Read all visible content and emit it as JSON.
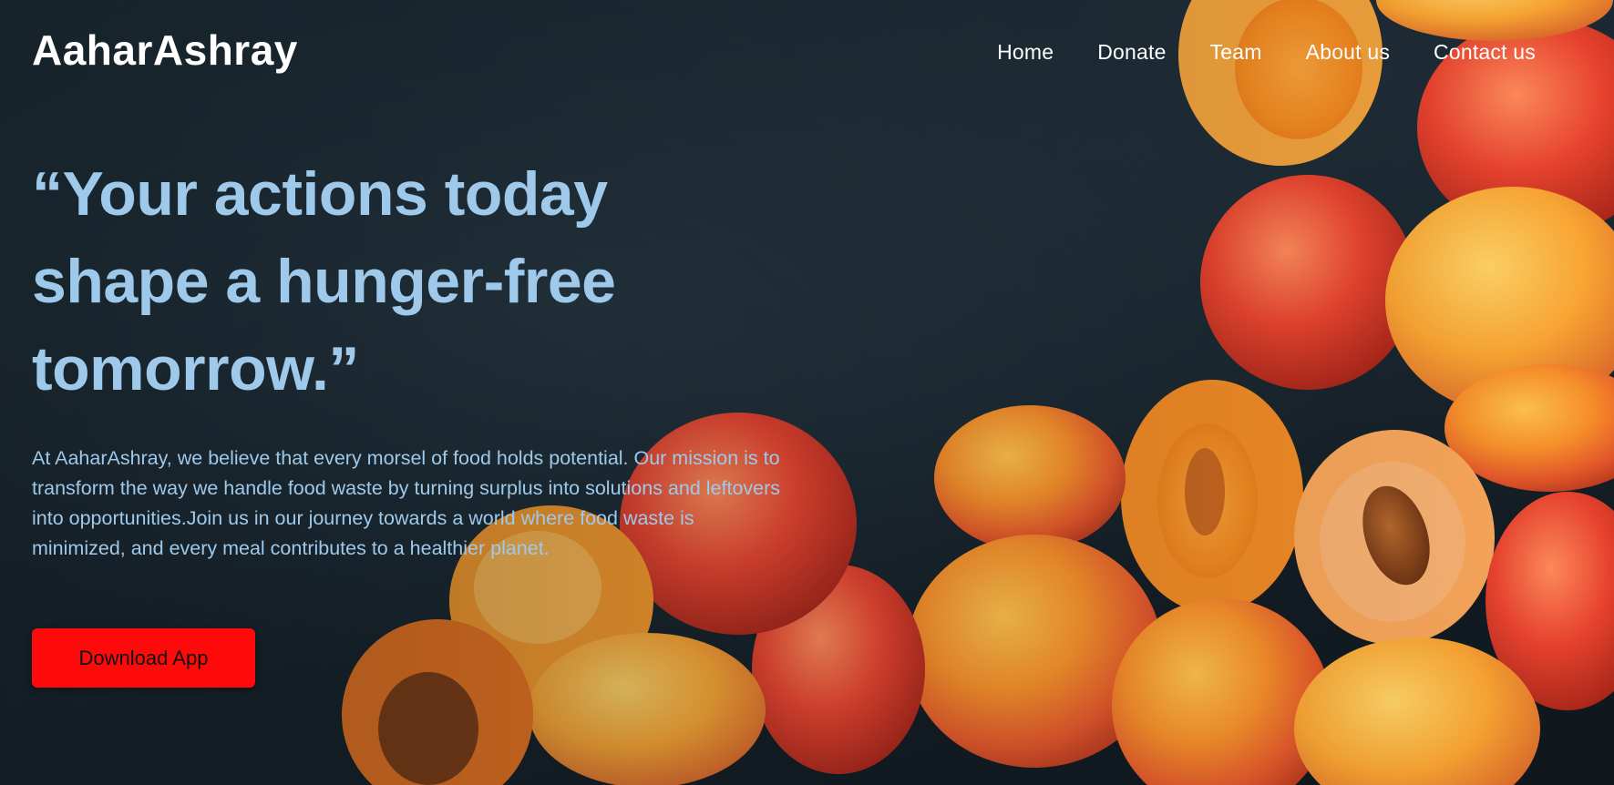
{
  "brand": {
    "name": "AaharAshray"
  },
  "nav": {
    "items": [
      {
        "label": "Home"
      },
      {
        "label": "Donate"
      },
      {
        "label": "Team"
      },
      {
        "label": "About us"
      },
      {
        "label": "Contact us"
      }
    ]
  },
  "hero": {
    "quote": "“Your actions today shape a hunger-free tomorrow.”",
    "description": "At AaharAshray, we believe that every morsel of food holds potential. Our mission is to transform the way we handle food waste by turning surplus into solutions and leftovers into opportunities.Join us in our journey towards a world where food waste is minimized, and every meal contributes to a healthier planet.",
    "cta_label": "Download App"
  },
  "colors": {
    "background": "#17232b",
    "accent_text": "#9ec9ea",
    "cta": "#ff0a0a",
    "nav_text": "#ffffff"
  }
}
